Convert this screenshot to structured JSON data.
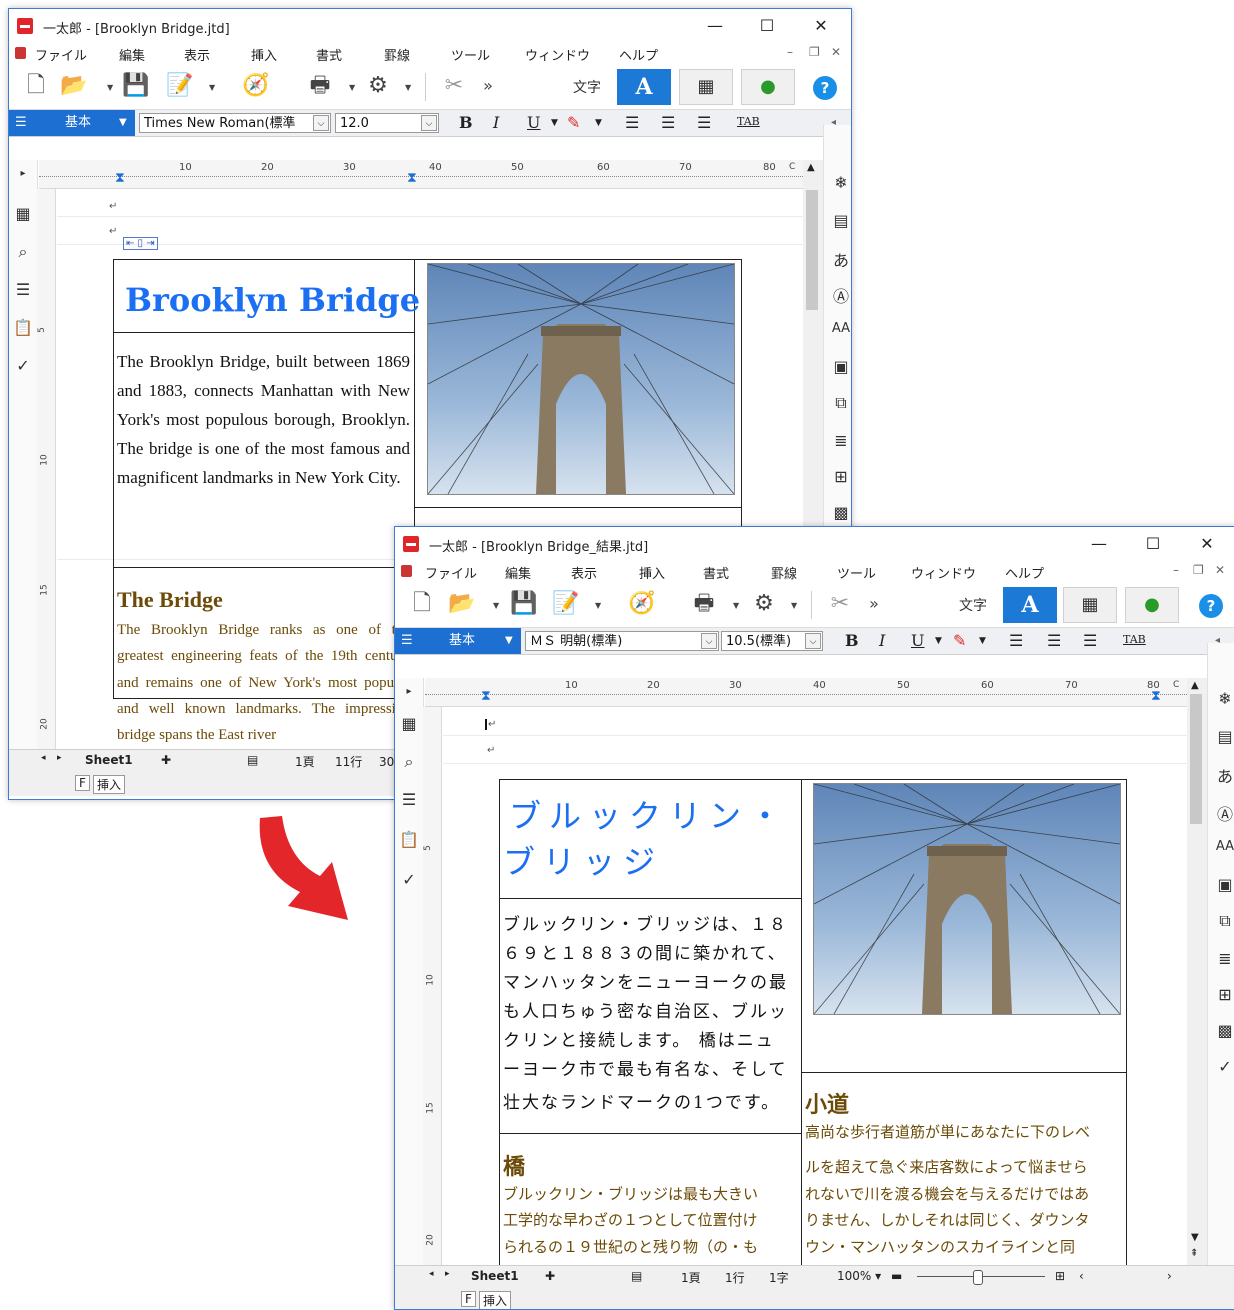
{
  "colors": {
    "accent": "#1d79d6",
    "title_blue": "#1a6ff2",
    "brown": "#6b4b07",
    "arrow_red": "#e3262a"
  },
  "window1": {
    "title": "一太郎 - [Brooklyn Bridge.jtd]",
    "menu": [
      "ファイル",
      "編集",
      "表示",
      "挿入",
      "書式",
      "罫線",
      "ツール",
      "ウィンドウ",
      "ヘルプ"
    ],
    "mode_text_label": "文字",
    "mode_A": "A",
    "style_name": "基本",
    "font_name": "Times New Roman(標準",
    "font_size": "12.0",
    "ruler_numbers": [
      "10",
      "20",
      "30",
      "40",
      "50",
      "60",
      "70",
      "80"
    ],
    "ruler_end": "C",
    "vruler": [
      "5",
      "10",
      "15",
      "20"
    ],
    "doc_title": "Brooklyn Bridge",
    "body": "The Brooklyn Bridge, built between 1869 and 1883, connects Manhattan with New York's most populous borough, Brooklyn. The bridge is one of the most famous and magnificent landmarks in New York City.",
    "section_heading": "The Bridge",
    "section_text": "The Brooklyn Bridge ranks as one of the greatest engineering feats of the 19th century and remains one of New York's most popular and well known landmarks. The impressive bridge spans the East river",
    "sheet_tab": "Sheet1",
    "status_page": "1頁",
    "status_line": "11行",
    "status_col": "30字",
    "fkey": "F",
    "insert_mode": "挿入"
  },
  "window2": {
    "title": "一太郎 - [Brooklyn Bridge_結果.jtd]",
    "menu": [
      "ファイル",
      "編集",
      "表示",
      "挿入",
      "書式",
      "罫線",
      "ツール",
      "ウィンドウ",
      "ヘルプ"
    ],
    "mode_text_label": "文字",
    "mode_A": "A",
    "style_name": "基本",
    "font_name": "ＭＳ 明朝(標準)",
    "font_size": "10.5(標準)",
    "ruler_numbers": [
      "10",
      "20",
      "30",
      "40",
      "50",
      "60",
      "70",
      "80"
    ],
    "ruler_end": "C",
    "vruler": [
      "5",
      "10",
      "15",
      "20"
    ],
    "doc_title_line1": "ブルックリン・",
    "doc_title_line2": "ブリッジ",
    "body": "ブルックリン・ブリッジは、１８６９と１８８３の間に築かれて、マンハッタンをニューヨークの最も人口ちゅう密な自治区、ブルックリンと接続します。 橋はニューヨーク市で最も有名な、そして壮大なランドマークの1つです。",
    "body_lines": [
      "ブルックリン・ブリッジは、１８",
      "６９と１８８３の間に築かれて、",
      "マンハッタンをニューヨークの最",
      "も人口ちゅう密な自治区、ブルッ",
      "クリンと接続します。 橋はニュ",
      "ーヨーク市で最も有名な、そして",
      "壮大なランドマークの1つです。"
    ],
    "left_heading": "橋",
    "left_text_lines": [
      "ブルックリン・ブリッジは最も大きい",
      "工学的な早わざの１つとして位置付け",
      "られるの１９世紀のと残り物（の・も"
    ],
    "right_heading": "小道",
    "right_text_lines": [
      "高尚な歩行者道筋が単にあなたに下のレベ",
      "ルを超えて急ぐ来店客数によって悩ませら",
      "れないで川を渡る機会を与えるだけではあ",
      "りません、しかしそれは同じく、ダウンタ",
      "ウン・マンハッタンのスカイラインと同"
    ],
    "sheet_tab": "Sheet1",
    "status_page": "1頁",
    "status_line": "1行",
    "status_col": "1字",
    "zoom": "100%",
    "fkey": "F",
    "insert_mode": "挿入"
  }
}
